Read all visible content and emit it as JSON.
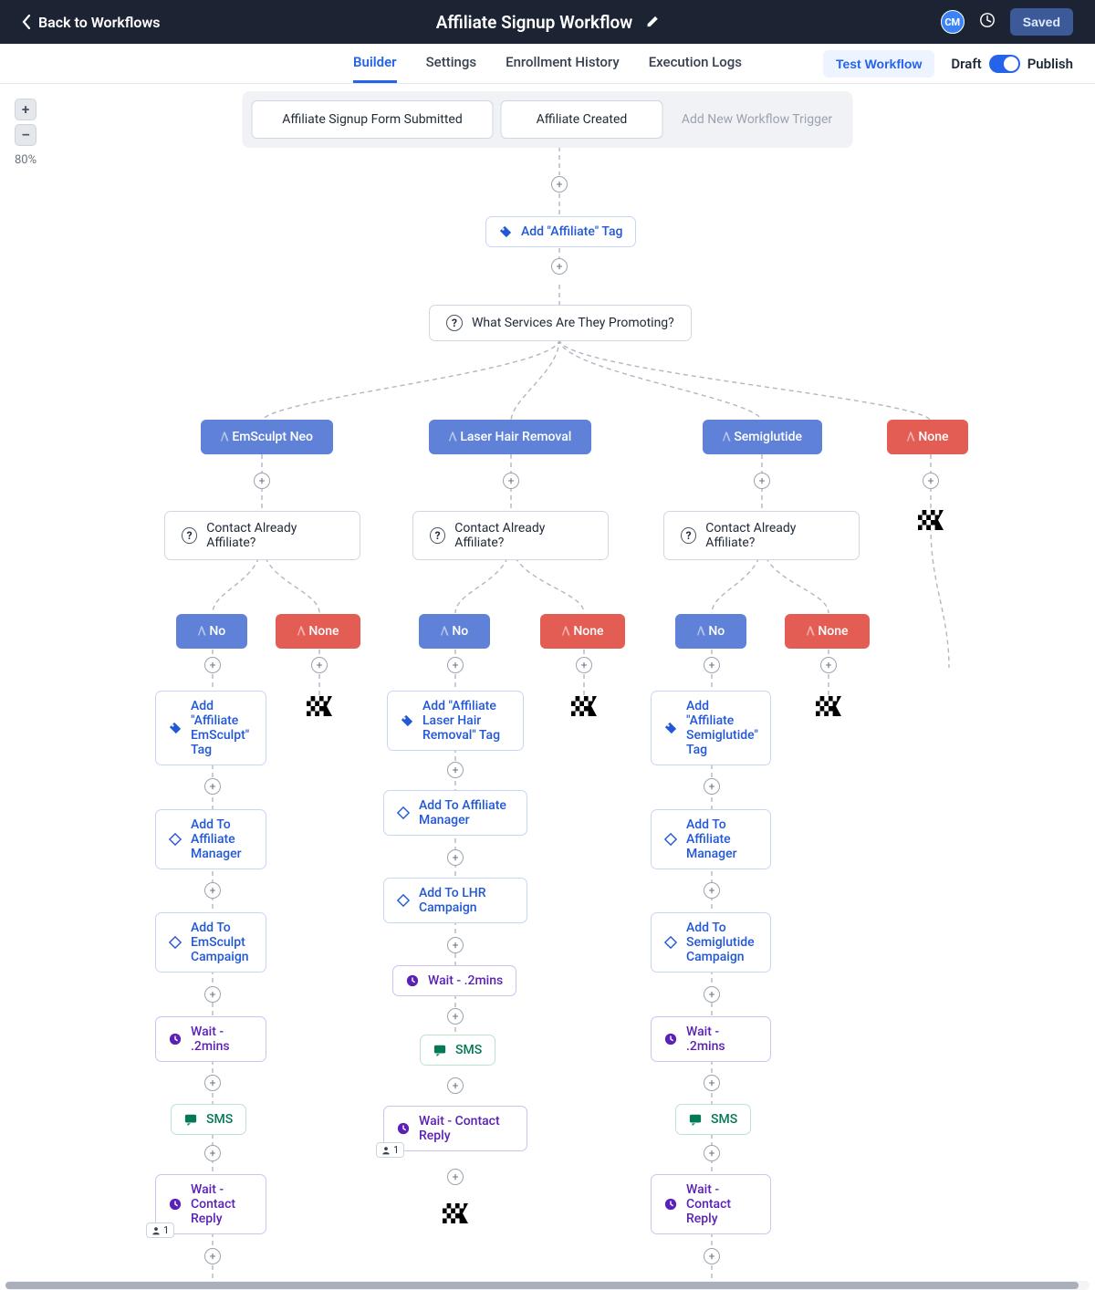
{
  "header": {
    "back": "Back to Workflows",
    "title": "Affiliate Signup Workflow",
    "avatar": "CM",
    "saved_btn": "Saved"
  },
  "tabs": {
    "items": [
      "Builder",
      "Settings",
      "Enrollment History",
      "Execution Logs"
    ],
    "active_index": 0,
    "test_btn": "Test Workflow",
    "draft": "Draft",
    "publish": "Publish"
  },
  "zoom": {
    "plus": "+",
    "minus": "–",
    "pct": "80%"
  },
  "triggers": {
    "t0": "Affiliate Signup Form Submitted",
    "t1": "Affiliate Created",
    "add": "Add New Workflow Trigger"
  },
  "root_action": "Add \"Affiliate\" Tag",
  "root_decision": "What Services Are They Promoting?",
  "svc": {
    "emsculpt": "EmSculpt Neo",
    "lhr": "Laser Hair Removal",
    "semi": "Semiglutide",
    "none": "None"
  },
  "aff_q": "Contact Already Affiliate?",
  "no": "No",
  "none": "None",
  "col_em": {
    "tag": "Add \"Affiliate EmSculpt\" Tag",
    "mgr": "Add To Affiliate Manager",
    "camp": "Add To EmSculpt Campaign",
    "wait": "Wait - .2mins",
    "sms": "SMS",
    "reply": "Wait - Contact Reply"
  },
  "col_lhr": {
    "tag": "Add \"Affiliate Laser Hair Removal\" Tag",
    "mgr": "Add To Affiliate Manager",
    "camp": "Add To LHR Campaign",
    "wait": "Wait - .2mins",
    "sms": "SMS",
    "reply": "Wait - Contact Reply"
  },
  "col_semi": {
    "tag": "Add \"Affiliate Semiglutide\" Tag",
    "mgr": "Add To Affiliate Manager",
    "camp": "Add To Semiglutide Campaign",
    "wait": "Wait - .2mins",
    "sms": "SMS",
    "reply": "Wait - Contact Reply"
  },
  "badge1": "1"
}
